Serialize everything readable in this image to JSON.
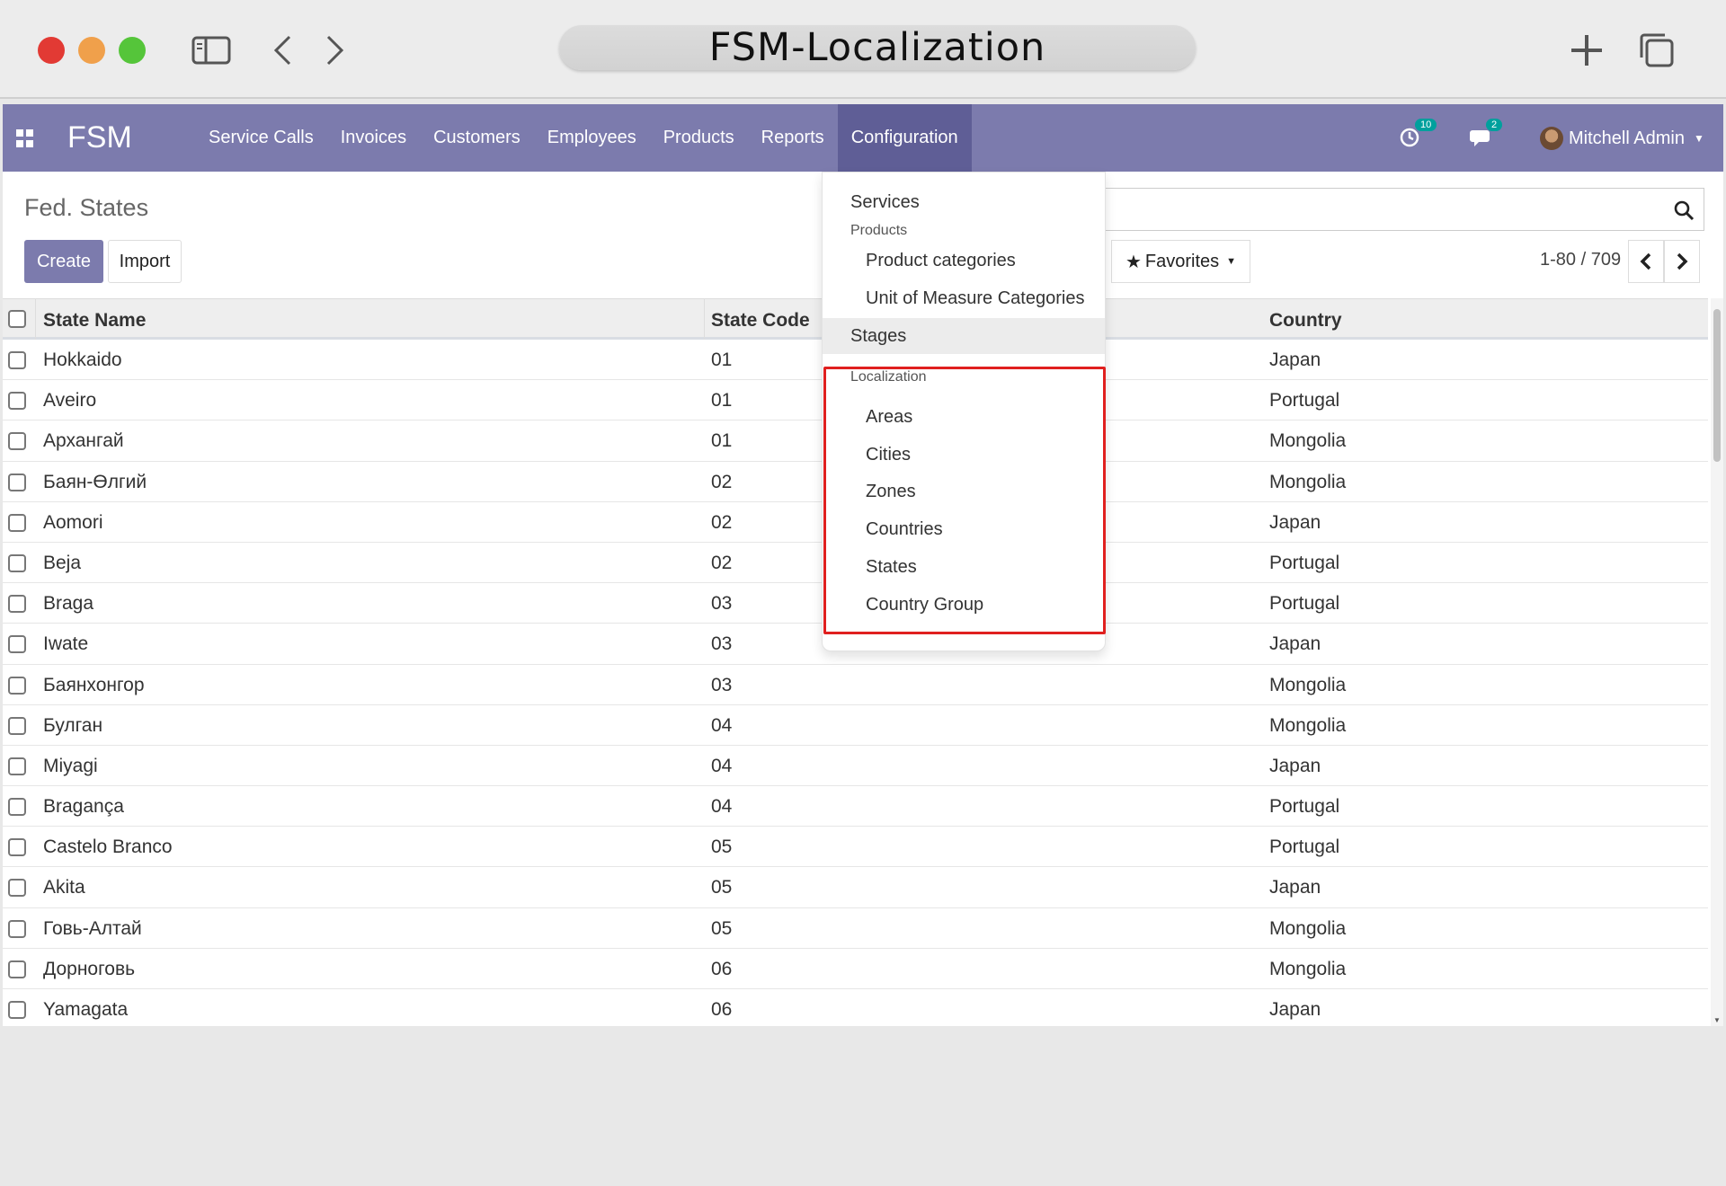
{
  "browser": {
    "address_text": "FSM-Localization"
  },
  "navbar": {
    "brand": "FSM",
    "menu": [
      "Service Calls",
      "Invoices",
      "Customers",
      "Employees",
      "Products",
      "Reports",
      "Configuration"
    ],
    "active_menu": "Configuration",
    "activity_count": "10",
    "message_count": "2",
    "user_name": "Mitchell Admin",
    "accent_color": "#7c7bad"
  },
  "control_panel": {
    "breadcrumb": "Fed. States",
    "create_label": "Create",
    "import_label": "Import",
    "favorites_label": "Favorites",
    "pager": "1-80 / 709"
  },
  "dropdown": {
    "items": {
      "services": "Services",
      "products_header": "Products",
      "product_categories": "Product categories",
      "uom_categories": "Unit of Measure Categories",
      "stages": "Stages",
      "localization_header": "Localization",
      "areas": "Areas",
      "cities": "Cities",
      "zones": "Zones",
      "countries": "Countries",
      "states": "States",
      "country_group": "Country Group"
    },
    "highlight_color": "#e0201f"
  },
  "table": {
    "columns": [
      "State Name",
      "State Code",
      "Country"
    ],
    "rows": [
      {
        "name": "Hokkaido",
        "code": "01",
        "country": "Japan"
      },
      {
        "name": "Aveiro",
        "code": "01",
        "country": "Portugal"
      },
      {
        "name": "Архангай",
        "code": "01",
        "country": "Mongolia"
      },
      {
        "name": "Баян-Өлгий",
        "code": "02",
        "country": "Mongolia"
      },
      {
        "name": "Aomori",
        "code": "02",
        "country": "Japan"
      },
      {
        "name": "Beja",
        "code": "02",
        "country": "Portugal"
      },
      {
        "name": "Braga",
        "code": "03",
        "country": "Portugal"
      },
      {
        "name": "Iwate",
        "code": "03",
        "country": "Japan"
      },
      {
        "name": "Баянхонгор",
        "code": "03",
        "country": "Mongolia"
      },
      {
        "name": "Булган",
        "code": "04",
        "country": "Mongolia"
      },
      {
        "name": "Miyagi",
        "code": "04",
        "country": "Japan"
      },
      {
        "name": "Bragança",
        "code": "04",
        "country": "Portugal"
      },
      {
        "name": "Castelo Branco",
        "code": "05",
        "country": "Portugal"
      },
      {
        "name": "Akita",
        "code": "05",
        "country": "Japan"
      },
      {
        "name": "Говь-Алтай",
        "code": "05",
        "country": "Mongolia"
      },
      {
        "name": "Дорноговь",
        "code": "06",
        "country": "Mongolia"
      },
      {
        "name": "Yamagata",
        "code": "06",
        "country": "Japan"
      }
    ]
  }
}
